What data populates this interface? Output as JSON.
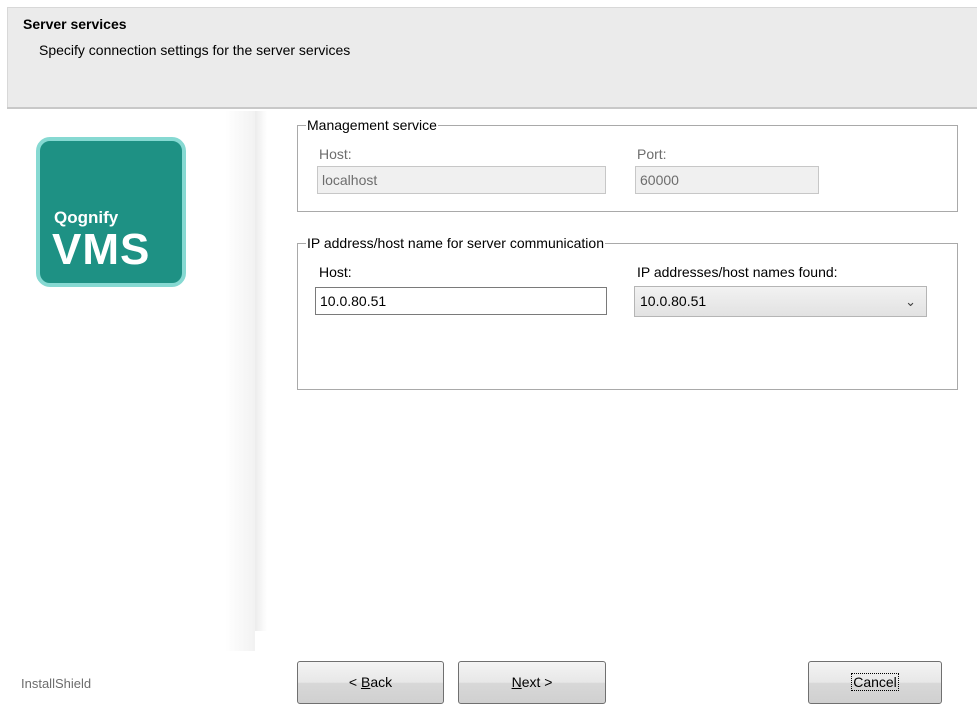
{
  "header": {
    "title": "Server services",
    "subtitle": "Specify connection settings for the server services"
  },
  "logo": {
    "small_text": "Qognify",
    "big_text": "VMS",
    "colors": {
      "fill": "#1e9184",
      "border": "#86d9d2"
    }
  },
  "management": {
    "legend": "Management service",
    "host_label": "Host:",
    "host_value": "localhost",
    "port_label": "Port:",
    "port_value": "60000"
  },
  "communication": {
    "legend": "IP address/host name for server communication",
    "host_label": "Host:",
    "host_value": "10.0.80.51",
    "found_label": "IP addresses/host names found:",
    "found_selected": "10.0.80.51",
    "dropdown_icon": "chevron-down-icon"
  },
  "footer": {
    "brand": "InstallShield",
    "back_prefix": "< ",
    "back_mnemonic": "B",
    "back_rest": "ack",
    "next_mnemonic": "N",
    "next_rest": "ext >",
    "cancel_label": "Cancel"
  }
}
